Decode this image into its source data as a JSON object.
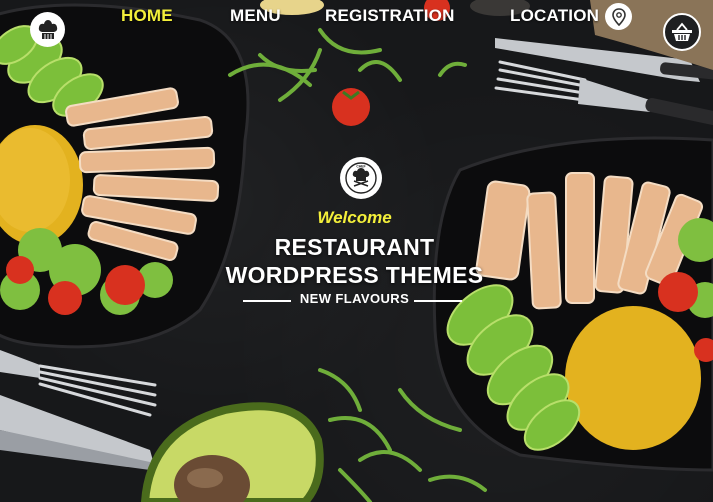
{
  "nav": {
    "items": [
      {
        "label": "HOME",
        "active": true
      },
      {
        "label": "MENU",
        "active": false
      },
      {
        "label": "REGISTRATION",
        "active": false
      },
      {
        "label": "LOCATION",
        "active": false
      }
    ],
    "logo_icon": "chef-hat-icon",
    "location_icon": "map-pin-icon",
    "cart_icon": "shopping-basket-icon"
  },
  "hero": {
    "emblem_icon": "chef-badge-icon",
    "emblem_text": "CHEF",
    "welcome": "Welcome",
    "title_line1": "RESTAURANT",
    "title_line2": "WORDPRESS THEMES",
    "subtitle": "NEW FLAVOURS"
  },
  "colors": {
    "accent": "#f3ef3a",
    "background": "#17181a",
    "text": "#ffffff"
  }
}
